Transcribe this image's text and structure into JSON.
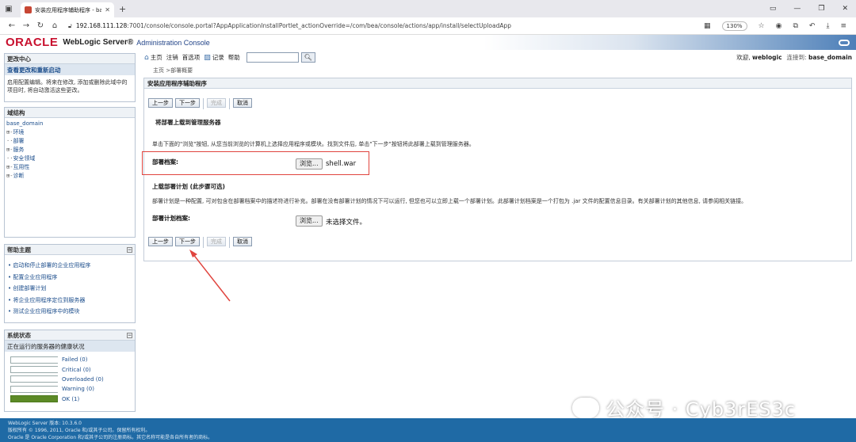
{
  "browser": {
    "tab_title": "安装应用程序辅助程序 - base_dom",
    "url_host": "192.168.111.128",
    "url_rest": ":7001/console/console.portal?AppApplicationInstallPortlet_actionOverride=/com/bea/console/actions/app/install/selectUploadApp",
    "zoom": "130%"
  },
  "header": {
    "logo": "ORACLE",
    "product": "WebLogic Server®",
    "console": "Administration Console"
  },
  "toolbar": {
    "home": "主页",
    "logout": "注销",
    "prefs": "首选项",
    "record": "记录",
    "help": "帮助",
    "welcome_label": "欢迎, ",
    "user": "weblogic",
    "connected_label": "连接到: ",
    "domain": "base_domain"
  },
  "breadcrumb": "主页 >部署概要",
  "change_center": {
    "title": "更改中心",
    "subtitle": "查看更改和重新启动",
    "text": "启用配置编辑。将来在修改, 添加或删除此域中的项目时, 将自动激活这些更改。"
  },
  "domain_structure": {
    "title": "域结构",
    "root": "base_domain",
    "nodes": [
      {
        "pre": "⊞-",
        "label": "环境"
      },
      {
        "pre": "··",
        "label": "部署"
      },
      {
        "pre": "⊞-",
        "label": "服务"
      },
      {
        "pre": "··",
        "label": "安全领域"
      },
      {
        "pre": "⊞-",
        "label": "互用性"
      },
      {
        "pre": "⊞-",
        "label": "诊断"
      }
    ]
  },
  "help_topics": {
    "title": "帮助主题",
    "items": [
      "启动和停止部署的企业应用程序",
      "配置企业应用程序",
      "创建部署计划",
      "将企业应用程序定位到服务器",
      "测试企业应用程序中的模块"
    ]
  },
  "system_status": {
    "title": "系统状态",
    "subtitle": "正在运行的服务器的健康状况",
    "rows": [
      {
        "label": "Failed (0)"
      },
      {
        "label": "Critical (0)"
      },
      {
        "label": "Overloaded (0)"
      },
      {
        "label": "Warning (0)"
      },
      {
        "label": "OK (1)"
      }
    ]
  },
  "main": {
    "title": "安装应用程序辅助程序",
    "buttons": {
      "back": "上一步",
      "next": "下一步",
      "finish": "完成",
      "cancel": "取消"
    },
    "section1_title": "将部署上载到管理服务器",
    "section1_desc": "单击下面的\"浏览\"按钮, 从您当前浏览的计算机上选择应用程序或模块。找到文件后, 单击\"下一步\"按钮将此部署上载到管理服务器。",
    "archive_label": "部署档案:",
    "browse_label": "浏览...",
    "archive_file": "shell.war",
    "section2_title": "上载部署计划 (此步骤可选)",
    "section2_desc": "部署计划是一种配置, 可对包含在部署档案中的描述符进行补充。部署在没有部署计划的情况下可以运行, 但您也可以立即上载一个部署计划。此部署计划档案是一个打包为 .jar 文件的配置信息目录。有关部署计划的其他信息, 请参阅相关链接。",
    "plan_label": "部署计划档案:",
    "plan_file": "未选择文件。"
  },
  "footer": {
    "line1": "WebLogic Server 版本: 10.3.6.0",
    "line2": "版权所有 © 1996, 2011, Oracle 和/或其子公司。保留所有权利。",
    "line3": "Oracle 是 Oracle Corporation 和/或其子公司的注册商标。其它名称可能是各自所有者的商标。"
  },
  "watermark": "公众号 · Cyb3rES3c",
  "colors": {
    "oracle_red": "#c8102e",
    "link_blue": "#1c4e8c",
    "footer_blue": "#1f6aa5",
    "ok_green": "#5c8a26",
    "annotation_red": "#e0443e"
  }
}
